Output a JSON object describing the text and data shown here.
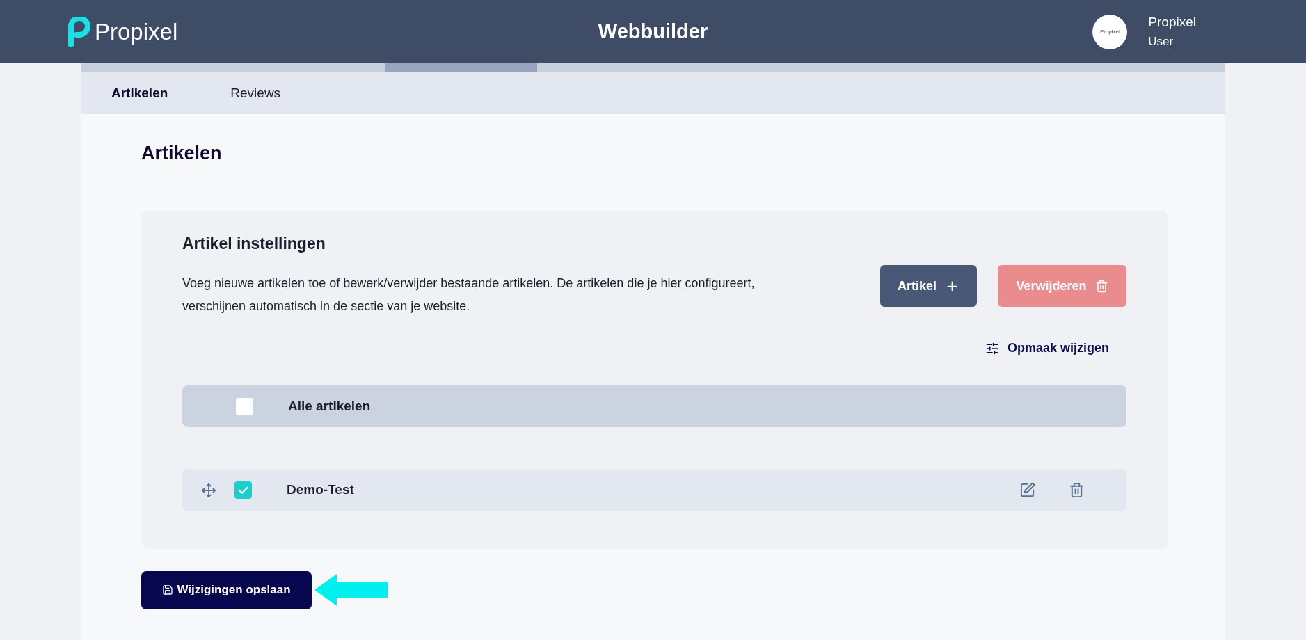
{
  "header": {
    "logo_text": "Propixel",
    "title": "Webbuilder",
    "user": {
      "avatar_text": "Propixel",
      "name": "Propixel",
      "role": "User"
    }
  },
  "tabs": [
    {
      "label": "Artikelen",
      "selected": true
    },
    {
      "label": "Reviews",
      "selected": false
    }
  ],
  "page_title": "Artikelen",
  "card": {
    "title": "Artikel instellingen",
    "description": "Voeg nieuwe artikelen toe of bewerk/verwijder bestaande artikelen. De artikelen die je hier configureert, verschijnen automatisch in de sectie van je website.",
    "buttons": [
      {
        "kind": "add",
        "label": "Artikel",
        "disabled": false
      },
      {
        "kind": "delete",
        "label": "Verwijderen",
        "disabled": true
      }
    ],
    "layout_link": "Opmaak wijzigen",
    "select_all": {
      "label": "Alle artikelen",
      "checked": false
    },
    "items": [
      {
        "label": "Demo-Test",
        "checked": true
      }
    ]
  },
  "save_button": "Wijzigingen opslaan"
}
